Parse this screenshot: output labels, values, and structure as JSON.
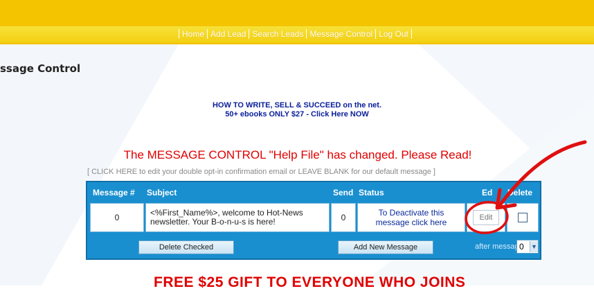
{
  "header": {
    "top_text": ""
  },
  "nav": {
    "items": [
      "Home",
      "Add Lead",
      "Search Leads",
      "Message Control",
      "Log Out"
    ]
  },
  "page": {
    "title": "ssage Control"
  },
  "promo": {
    "line1": "HOW TO WRITE, SELL & SUCCEED on the net.",
    "line2": "50+ ebooks ONLY $27 - Click Here NOW"
  },
  "notice": {
    "text": "The MESSAGE CONTROL \"Help File\" has changed. Please Read!"
  },
  "optin_link": {
    "text": "[ CLICK HERE to edit your double opt-in confirmation email or LEAVE BLANK for our default message ]"
  },
  "table": {
    "headers": {
      "message_num": "Message #",
      "subject": "Subject",
      "send": "Send",
      "status": "Status",
      "edit": "Ed",
      "delete": "Delete"
    },
    "rows": [
      {
        "message_num": "0",
        "subject": "<%First_Name%>, welcome to Hot-News newsletter. Your B-o-n-u-s is here!",
        "send": "0",
        "status": "To Deactivate this message click here",
        "edit": "Edit"
      }
    ],
    "delete_checked": "Delete Checked",
    "add_new": "Add New Message",
    "after_label": "after message",
    "after_value": "0"
  },
  "footer": {
    "title": "FREE $25 GIFT TO EVERYONE WHO JOINS"
  },
  "colors": {
    "yellow": "#f5c400",
    "table_blue": "#1a8fd0",
    "red": "#e00000",
    "promo_blue": "#0a1e9a"
  }
}
